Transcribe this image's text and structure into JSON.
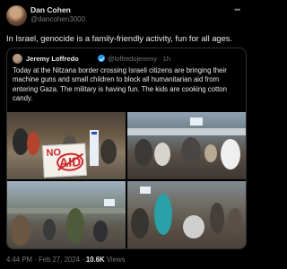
{
  "tweet": {
    "author_name": "Dan Cohen",
    "author_handle": "@dancohen3000",
    "more_icon": "more-icon",
    "text": "In Israel, genocide is a family-friendly activity, fun for all ages.",
    "timestamp": "4:44 PM · Feb 27, 2024 · ",
    "views_count": "10.6K",
    "views_label": " Views"
  },
  "quote": {
    "author_name": "Jeremy Loffredo",
    "verified_icon": "verified-badge-icon",
    "author_handle": "@loffredojeremy · 1h",
    "text": "Today at the Nitzana border crossing Israeli citizens are bringing their machine guns and small children to block all humanitarian aid from entering Gaza. The military is having fun. The kids are cooking cotton candy.",
    "sign_text_top": "NO",
    "sign_text_main": "AID"
  }
}
